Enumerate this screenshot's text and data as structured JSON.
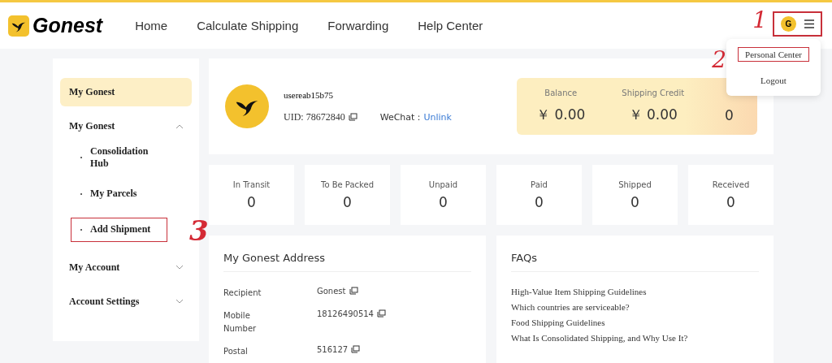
{
  "header": {
    "logo": "Gonest",
    "nav": [
      "Home",
      "Calculate Shipping",
      "Forwarding",
      "Help Center"
    ],
    "user_menu": {
      "initial": "G",
      "annotation": "1"
    }
  },
  "dropdown": {
    "items": [
      {
        "label": "Personal Center",
        "annotation": "2"
      },
      {
        "label": "Logout"
      }
    ]
  },
  "sidebar": {
    "items": [
      {
        "kind": "link",
        "label": "My Gonest",
        "selected": true
      },
      {
        "kind": "group",
        "label": "My Gonest",
        "selected": false,
        "expanded": true,
        "children": [
          {
            "label": "Consolidation Hub"
          },
          {
            "label": "My Parcels"
          },
          {
            "label": "Add Shipment",
            "annotation": "3"
          }
        ]
      },
      {
        "kind": "group",
        "label": "My Account",
        "selected": false,
        "expanded": false
      },
      {
        "kind": "group",
        "label": "Account Settings",
        "selected": false,
        "expanded": false
      }
    ]
  },
  "profile": {
    "username": "usereab15b75",
    "uid": "UID: 78672840",
    "wechat_label": "WeChat：",
    "wechat_link": "Unlink"
  },
  "wallet": [
    {
      "label": "Balance",
      "value": "￥ 0.00"
    },
    {
      "label": "Shipping Credit",
      "value": "￥ 0.00"
    },
    {
      "value": "0"
    }
  ],
  "stats": [
    {
      "label": "In Transit",
      "value": "0"
    },
    {
      "label": "To Be Packed",
      "value": "0"
    },
    {
      "label": "Unpaid",
      "value": "0"
    },
    {
      "label": "Paid",
      "value": "0"
    },
    {
      "label": "Shipped",
      "value": "0"
    },
    {
      "label": "Received",
      "value": "0"
    }
  ],
  "address": {
    "title": "My Gonest Address",
    "rows": [
      {
        "label": "Recipient",
        "value": "Gonest"
      },
      {
        "label": "Mobile Number",
        "value": "18126490514"
      },
      {
        "label": "Postal",
        "value": "516127"
      }
    ]
  },
  "faqs": {
    "title": "FAQs",
    "items": [
      "High-Value Item Shipping Guidelines",
      "Which countries are serviceable?",
      "Food Shipping Guidelines",
      "What Is Consolidated Shipping, and Why Use It?"
    ]
  }
}
